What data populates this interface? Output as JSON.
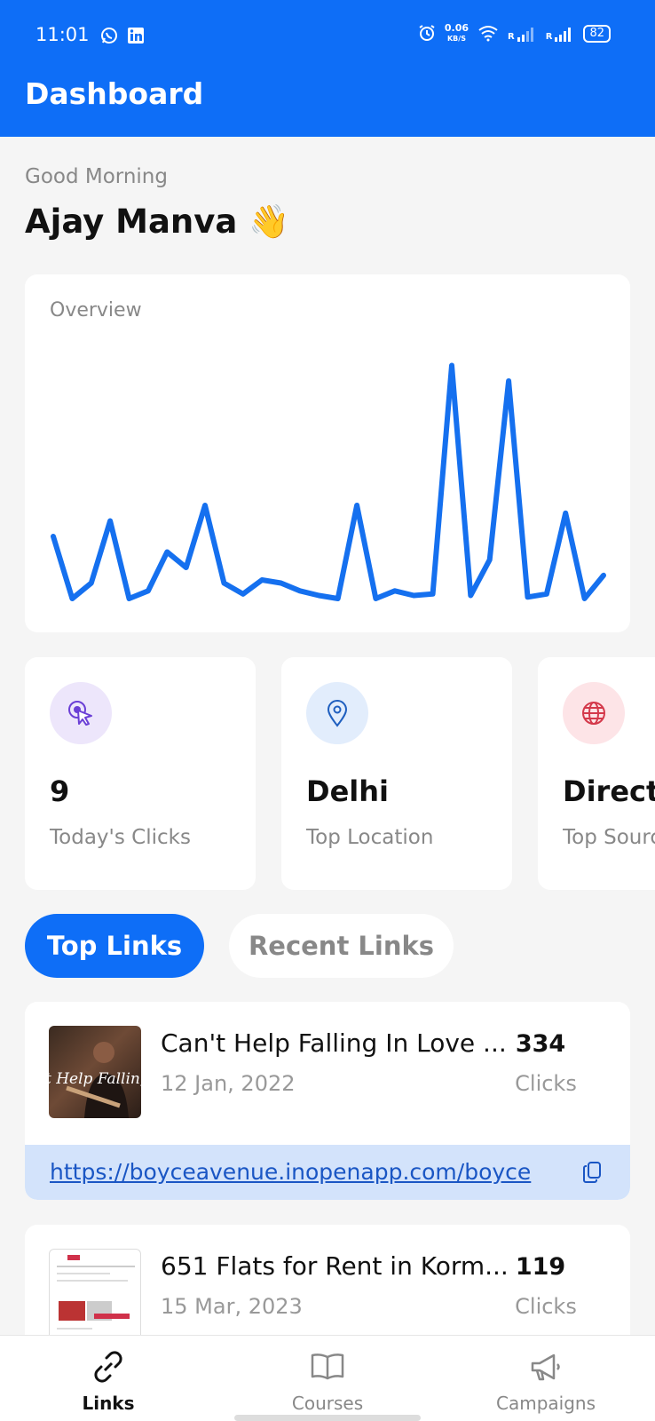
{
  "status_bar": {
    "time": "11:01",
    "net_speed_value": "0.06",
    "net_speed_unit": "KB/S",
    "signal_1_label": "R",
    "signal_2_label": "R",
    "battery": "82",
    "left_icons": [
      "whatsapp-icon",
      "linkedin-icon"
    ],
    "right_icons": [
      "alarm-icon",
      "wifi-icon",
      "signal-icon",
      "signal-icon"
    ]
  },
  "header": {
    "title": "Dashboard"
  },
  "greeting": {
    "salutation": "Good Morning",
    "name": "Ajay Manva 👋"
  },
  "overview": {
    "label": "Overview",
    "chart_data": {
      "type": "line",
      "title": "Overview",
      "series": [
        {
          "values": [
            4,
            0,
            1,
            5,
            0,
            0.5,
            3,
            2,
            6,
            1,
            0.3,
            1.2,
            1,
            0.5,
            0.2,
            0,
            6,
            0,
            0.5,
            0.2,
            0.3,
            15,
            0.2,
            2.5,
            14,
            0.1,
            0.3,
            5.5,
            0,
            1.5
          ]
        }
      ],
      "ylim": [
        0,
        16
      ],
      "grid": false,
      "color": "#1570ef"
    }
  },
  "stats": [
    {
      "icon": "cursor-click-icon",
      "value": "9",
      "label": "Today's Clicks",
      "bg": "#ede6fb",
      "fg": "#6b3fd6"
    },
    {
      "icon": "map-pin-icon",
      "value": "Delhi",
      "label": "Top Location",
      "bg": "#e2edfc",
      "fg": "#1f5fbf"
    },
    {
      "icon": "globe-icon",
      "value": "Direct",
      "label": "Top Source",
      "bg": "#fde4e7",
      "fg": "#d4394b"
    }
  ],
  "tabs": {
    "active": "Top Links",
    "inactive": "Recent Links"
  },
  "links": [
    {
      "title": "Can't Help Falling In Love ...",
      "date": "12 Jan, 2022",
      "count": "334",
      "clicks_label": "Clicks",
      "url": "https://boyceavenue.inopenapp.com/boyce",
      "thumb_caption": "t Help Falling In"
    },
    {
      "title": "651   Flats for Rent in Korm...",
      "date": "15 Mar, 2023",
      "count": "119",
      "clicks_label": "Clicks"
    }
  ],
  "bottom_nav": [
    {
      "label": "Links",
      "icon": "link-icon",
      "active": true
    },
    {
      "label": "Courses",
      "icon": "book-icon",
      "active": false
    },
    {
      "label": "Campaigns",
      "icon": "megaphone-icon",
      "active": false
    }
  ]
}
